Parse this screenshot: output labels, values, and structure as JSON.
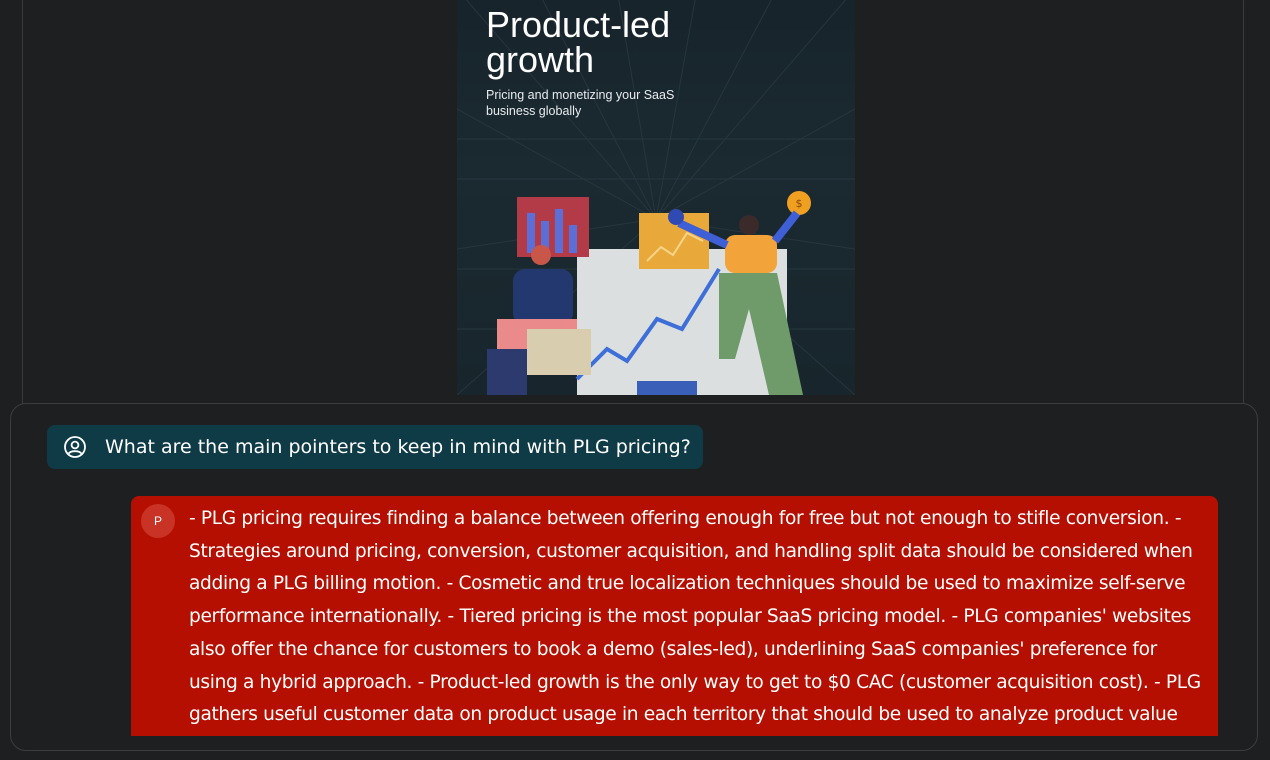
{
  "document": {
    "title": "Product-led growth",
    "subtitle": "Pricing and monetizing your SaaS business globally"
  },
  "chat": {
    "user_message": "What are the main pointers to keep in mind with PLG pricing?",
    "bot_avatar_letter": "P",
    "bot_message": "- PLG pricing requires finding a balance between offering enough for free but not enough to stifle conversion. - Strategies around pricing, conversion, customer acquisition, and handling split data should be considered when adding a PLG billing motion. - Cosmetic and true localization techniques should be used to maximize self-serve performance internationally. - Tiered pricing is the most popular SaaS pricing model. - PLG companies' websites also offer the chance for customers to book a demo (sales-led), underlining SaaS companies' preference for using a hybrid approach. - Product-led growth is the only way to get to $0 CAC (customer acquisition cost). - PLG gathers useful customer data on product usage in each territory that should be used to analyze product value and influence"
  },
  "colors": {
    "background": "#1e1f21",
    "user_bubble": "#0f3b47",
    "bot_bubble": "#b40f00"
  }
}
